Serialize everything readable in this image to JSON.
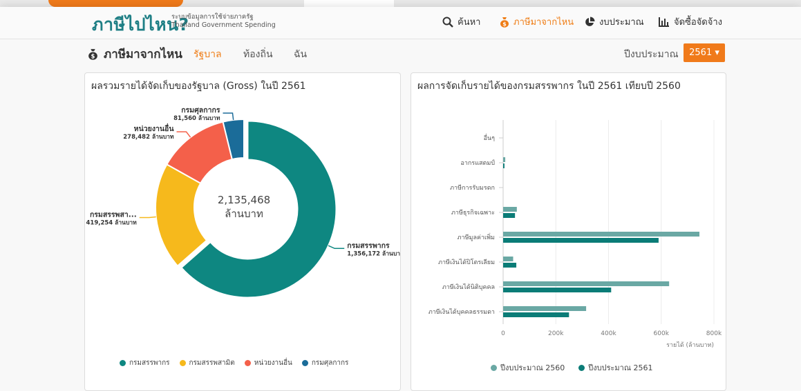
{
  "header": {
    "logo": "ภาษีไปไหน?",
    "tagline_line1": "ระบบข้อมูลการใช้จ่ายภาครัฐ",
    "tagline_line2": "Thailand Government Spending",
    "nav": [
      {
        "label": "ค้นหา",
        "icon": "search-icon"
      },
      {
        "label": "ภาษีมาจากไหน",
        "icon": "money-bag-icon",
        "active": true
      },
      {
        "label": "งบประมาณ",
        "icon": "pie-chart-icon"
      },
      {
        "label": "จัดซื้อจัดจ้าง",
        "icon": "bar-chart-icon"
      }
    ]
  },
  "subbar": {
    "title": "ภาษีมาจากไหน",
    "tabs": [
      {
        "label": "รัฐบาล",
        "active": true
      },
      {
        "label": "ท้องถิ่น"
      },
      {
        "label": "ฉัน"
      }
    ],
    "budget_label": "ปีงบประมาณ",
    "budget_year": "2561 ▾"
  },
  "colors": {
    "accent": "#ef7d16",
    "teal": "#0e8781",
    "gold": "#f6b91c",
    "coral": "#f4604a",
    "blue": "#1b6c99",
    "teal_light": "#6aa8a4",
    "teal_dark": "#0b7c77"
  },
  "left_card": {
    "title": "ผลรวมรายได้จัดเก็บของรัฐบาล (Gross) ในปี 2561",
    "center_value": "2,135,468",
    "center_unit": "ล้านบาท"
  },
  "right_card": {
    "title": "ผลการจัดเก็บรายได้ของกรมสรรพากร ในปี 2561 เทียบปี 2560"
  },
  "chart_data": [
    {
      "type": "pie",
      "title": "ผลรวมรายได้จัดเก็บของรัฐบาล (Gross) ในปี 2561",
      "categories": [
        "กรมสรรพากร",
        "กรมสรรพสามิต",
        "หน่วยงานอื่น",
        "กรมศุลกากร"
      ],
      "values": [
        1356172,
        419254,
        278482,
        81560
      ],
      "slice_labels": [
        "กรมสรรพากร",
        "กรมสรรพสา...",
        "หน่วยงานอื่น",
        "กรมศุลกากร"
      ],
      "value_labels": [
        "1,356,172 ล้านบาท",
        "419,254 ล้านบาท",
        "278,482 ล้านบาท",
        "81,560 ล้านบาท"
      ],
      "colors": [
        "#0e8781",
        "#f6b91c",
        "#f4604a",
        "#1b6c99"
      ],
      "legend": "bottom"
    },
    {
      "type": "bar",
      "title": "ผลการจัดเก็บรายได้ของกรมสรรพากร ในปี 2561 เทียบปี 2560",
      "orientation": "horizontal",
      "categories": [
        "อื่นๆ",
        "อากรแสตมป์",
        "ภาษีการรับมรดก",
        "ภาษีธุรกิจเฉพาะ",
        "ภาษีมูลค่าเพิ่ม",
        "ภาษีเงินได้ปิโตรเลียม",
        "ภาษีเงินได้นิติบุคคล",
        "ภาษีเงินได้บุคคลธรรมดา"
      ],
      "series": [
        {
          "name": "ปีงบประมาณ 2560",
          "values": [
            0,
            8,
            0,
            52,
            745,
            38,
            630,
            315
          ],
          "color": "#6aa8a4"
        },
        {
          "name": "ปีงบประมาณ 2561",
          "values": [
            0,
            5,
            0,
            45,
            590,
            50,
            410,
            250
          ],
          "color": "#0b7c77"
        }
      ],
      "xlim": [
        0,
        800
      ],
      "xticks": [
        "0",
        "200k",
        "400k",
        "600k",
        "800k"
      ],
      "xlabel": "รายได้ (ล้านบาท)",
      "grid": true,
      "legend": "bottom"
    }
  ]
}
